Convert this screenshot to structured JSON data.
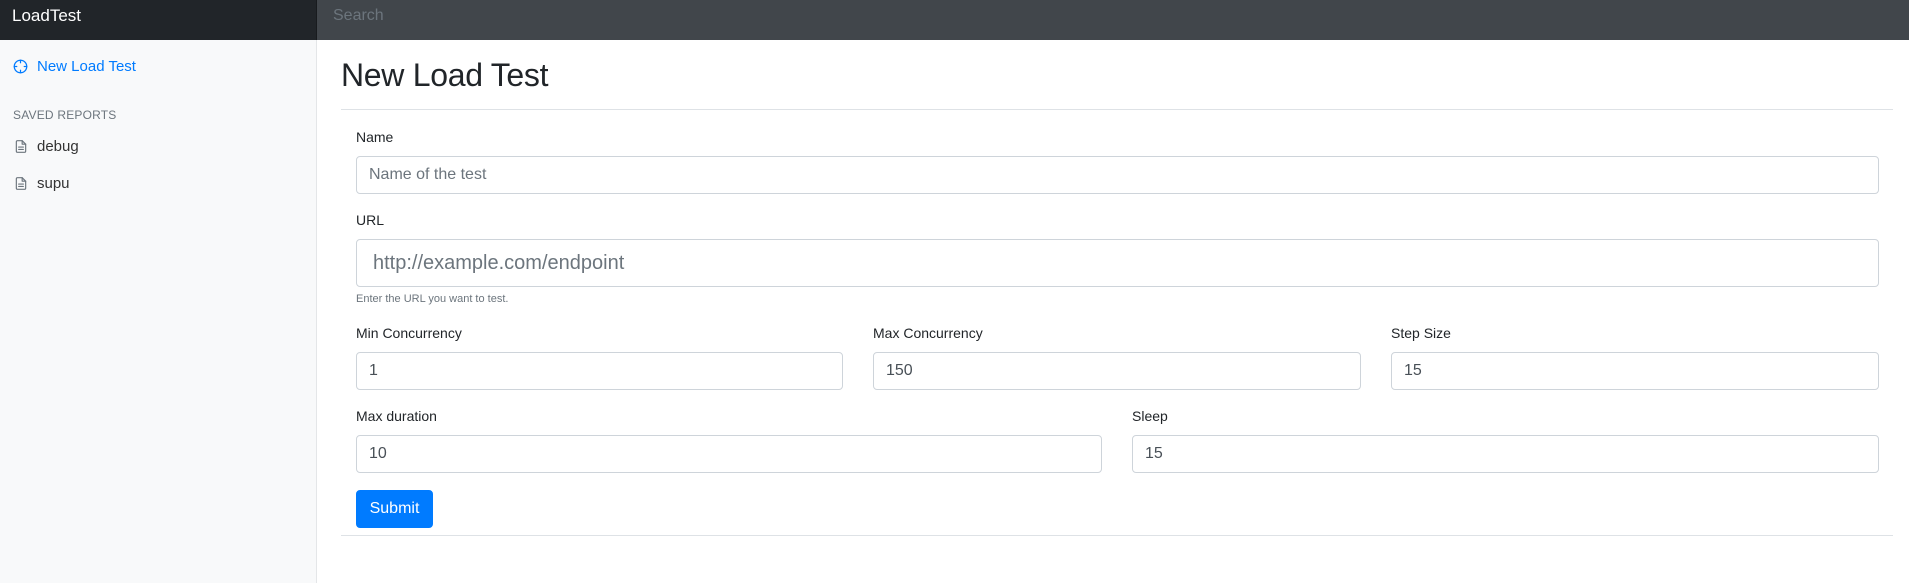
{
  "app": {
    "brand": "LoadTest"
  },
  "search": {
    "placeholder": "Search"
  },
  "sidebar": {
    "new_link": {
      "label": "New Load Test",
      "icon": "crosshair-icon"
    },
    "saved_heading": "SAVED REPORTS",
    "reports": [
      {
        "label": "debug",
        "icon": "file-text-icon"
      },
      {
        "label": "supu",
        "icon": "file-text-icon"
      }
    ]
  },
  "page": {
    "title": "New Load Test"
  },
  "form": {
    "name": {
      "label": "Name",
      "placeholder": "Name of the test",
      "value": ""
    },
    "url": {
      "label": "URL",
      "placeholder": "http://example.com/endpoint",
      "value": "",
      "help": "Enter the URL you want to test."
    },
    "min_concurrency": {
      "label": "Min Concurrency",
      "value": "1"
    },
    "max_concurrency": {
      "label": "Max Concurrency",
      "value": "150"
    },
    "step_size": {
      "label": "Step Size",
      "value": "15"
    },
    "max_duration": {
      "label": "Max duration",
      "value": "10"
    },
    "sleep": {
      "label": "Sleep",
      "value": "15"
    },
    "submit_label": "Submit"
  },
  "colors": {
    "accent": "#007bff",
    "topbar": "#343a40",
    "brand_bg": "#212529",
    "sidebar_bg": "#f8f9fa"
  }
}
